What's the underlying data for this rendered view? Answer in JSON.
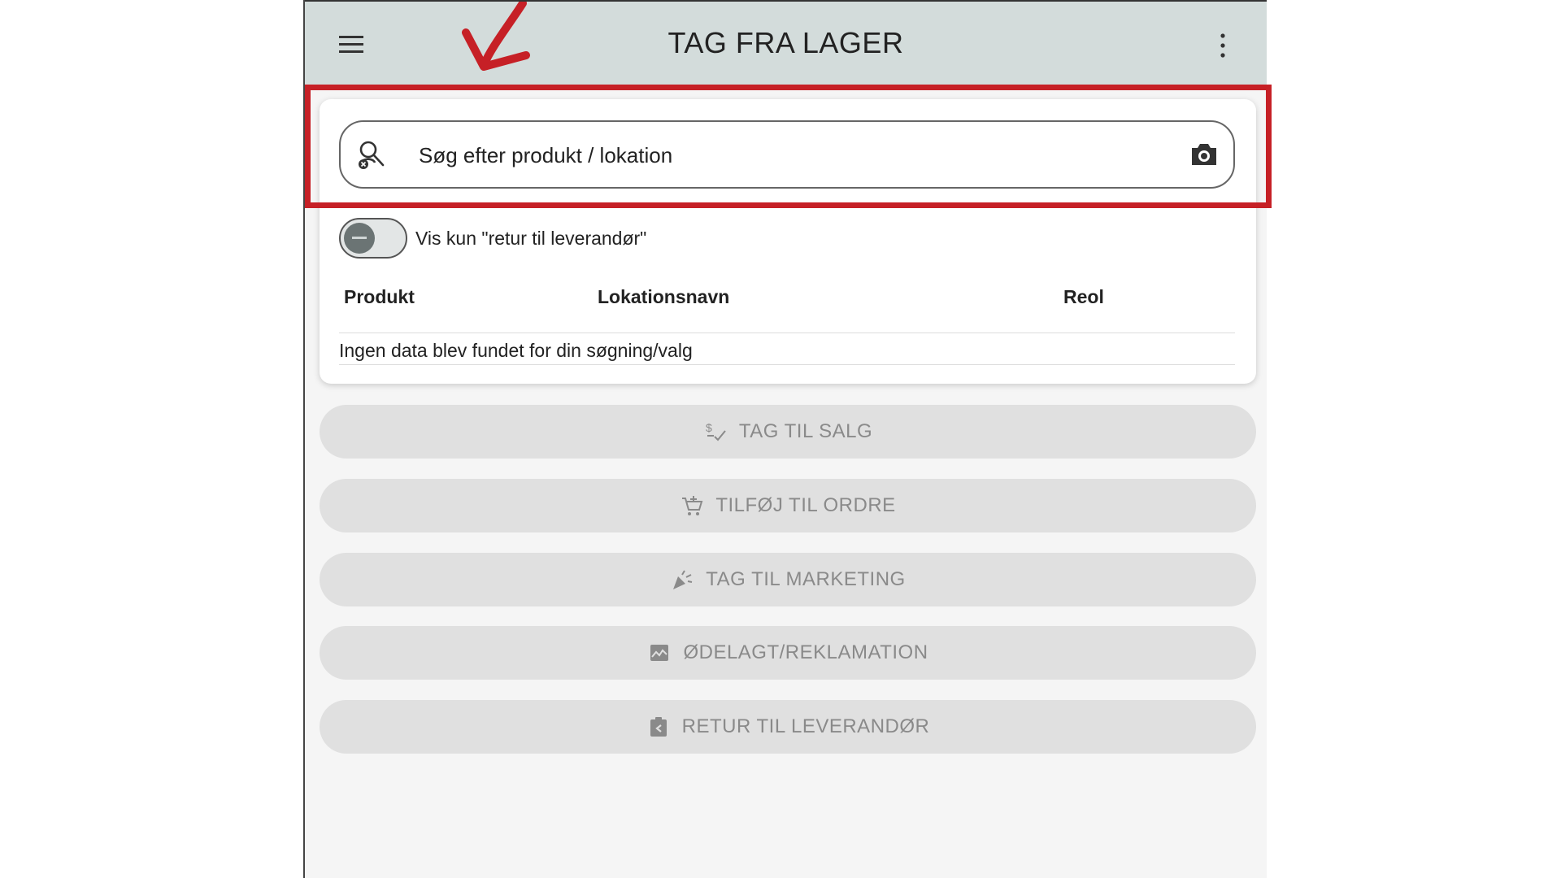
{
  "header": {
    "title": "TAG FRA LAGER"
  },
  "search": {
    "placeholder": "Søg efter produkt / lokation"
  },
  "filter": {
    "toggle_label": "Vis kun \"retur til leverandør\"",
    "toggle_on": false
  },
  "table": {
    "columns": [
      "Produkt",
      "Lokationsnavn",
      "Reol"
    ],
    "empty_message": "Ingen data blev fundet for din søgning/valg"
  },
  "actions": [
    {
      "label": "TAG TIL SALG",
      "icon": "dollar-check-icon"
    },
    {
      "label": "TILFØJ TIL ORDRE",
      "icon": "cart-add-icon"
    },
    {
      "label": "TAG TIL MARKETING",
      "icon": "party-popper-icon"
    },
    {
      "label": "ØDELAGT/REKLAMATION",
      "icon": "broken-image-icon"
    },
    {
      "label": "RETUR TIL LEVERANDØR",
      "icon": "return-box-icon"
    }
  ],
  "colors": {
    "appbar": "#d3dcdb",
    "highlight": "#c62026",
    "button_bg": "#e0e0e0",
    "button_text": "#8a8a8a"
  }
}
